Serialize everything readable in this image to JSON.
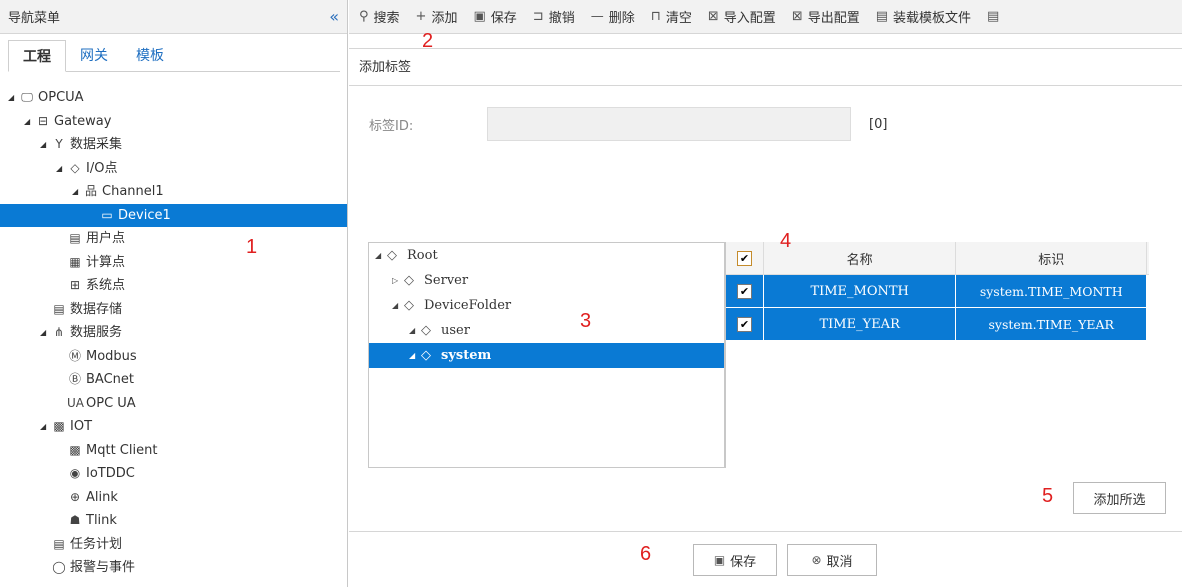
{
  "nav": {
    "title": "导航菜单",
    "collapse_icon": "«",
    "tabs": [
      {
        "label": "工程",
        "active": true
      },
      {
        "label": "网关",
        "active": false
      },
      {
        "label": "模板",
        "active": false
      }
    ],
    "tree": [
      {
        "label": "OPCUA",
        "level": 0,
        "arrow": "◢",
        "icon": "monitor-icon",
        "glyph": "🖵"
      },
      {
        "label": "Gateway",
        "level": 1,
        "arrow": "◢",
        "icon": "gateway-icon",
        "glyph": "⊟"
      },
      {
        "label": "数据采集",
        "level": 2,
        "arrow": "◢",
        "icon": "collect-icon",
        "glyph": "Y"
      },
      {
        "label": "I/O点",
        "level": 3,
        "arrow": "◢",
        "icon": "tag-icon",
        "glyph": "◇"
      },
      {
        "label": "Channel1",
        "level": 4,
        "arrow": "◢",
        "icon": "channel-icon",
        "glyph": "品"
      },
      {
        "label": "Device1",
        "level": 5,
        "arrow": "",
        "icon": "device-icon",
        "glyph": "▭",
        "selected": true
      },
      {
        "label": "用户点",
        "level": 3,
        "arrow": "",
        "icon": "user-point-icon",
        "glyph": "▤"
      },
      {
        "label": "计算点",
        "level": 3,
        "arrow": "",
        "icon": "calc-point-icon",
        "glyph": "▦"
      },
      {
        "label": "系统点",
        "level": 3,
        "arrow": "",
        "icon": "system-point-icon",
        "glyph": "⊞"
      },
      {
        "label": "数据存储",
        "level": 2,
        "arrow": "",
        "icon": "storage-icon",
        "glyph": "▤"
      },
      {
        "label": "数据服务",
        "level": 2,
        "arrow": "◢",
        "icon": "service-icon",
        "glyph": "⋔"
      },
      {
        "label": "Modbus",
        "level": 3,
        "arrow": "",
        "icon": "modbus-icon",
        "glyph": "Ⓜ"
      },
      {
        "label": "BACnet",
        "level": 3,
        "arrow": "",
        "icon": "bacnet-icon",
        "glyph": "Ⓑ"
      },
      {
        "label": "OPC UA",
        "level": 3,
        "arrow": "",
        "icon": "opcua-icon",
        "glyph": "UA"
      },
      {
        "label": "IOT",
        "level": 2,
        "arrow": "◢",
        "icon": "iot-icon",
        "glyph": "▩"
      },
      {
        "label": "Mqtt Client",
        "level": 3,
        "arrow": "",
        "icon": "mqtt-icon",
        "glyph": "▩"
      },
      {
        "label": "IoTDDC",
        "level": 3,
        "arrow": "",
        "icon": "iotddc-icon",
        "glyph": "◉"
      },
      {
        "label": "Alink",
        "level": 3,
        "arrow": "",
        "icon": "alink-icon",
        "glyph": "⊕"
      },
      {
        "label": "Tlink",
        "level": 3,
        "arrow": "",
        "icon": "tlink-icon",
        "glyph": "☗"
      },
      {
        "label": "任务计划",
        "level": 2,
        "arrow": "",
        "icon": "task-icon",
        "glyph": "▤"
      },
      {
        "label": "报警与事件",
        "level": 2,
        "arrow": "",
        "icon": "alarm-icon",
        "glyph": "◯"
      }
    ]
  },
  "toolbar": [
    {
      "label": "搜索",
      "icon": "search-icon",
      "glyph": "⚲"
    },
    {
      "label": "添加",
      "icon": "plus-icon",
      "glyph": "+"
    },
    {
      "label": "保存",
      "icon": "save-icon",
      "glyph": "▣"
    },
    {
      "label": "撤销",
      "icon": "undo-icon",
      "glyph": "⊐"
    },
    {
      "label": "删除",
      "icon": "minus-icon",
      "glyph": "—"
    },
    {
      "label": "清空",
      "icon": "trash-icon",
      "glyph": "⊓"
    },
    {
      "label": "导入配置",
      "icon": "import-icon",
      "glyph": "⊠"
    },
    {
      "label": "导出配置",
      "icon": "export-icon",
      "glyph": "⊠"
    },
    {
      "label": "装载模板文件",
      "icon": "file-icon",
      "glyph": "▤"
    },
    {
      "label": "",
      "icon": "file-icon",
      "glyph": "▤"
    }
  ],
  "dialog": {
    "title": "添加标签",
    "tag_id_label": "标签ID:",
    "tag_id_value": "",
    "tag_index": "[0]",
    "tag_tree": [
      {
        "label": "Root",
        "level": 0,
        "arrow": "◢"
      },
      {
        "label": "Server",
        "level": 1,
        "arrow": "▷"
      },
      {
        "label": "DeviceFolder",
        "level": 1,
        "arrow": "◢"
      },
      {
        "label": "user",
        "level": 2,
        "arrow": "◢"
      },
      {
        "label": "system",
        "level": 2,
        "arrow": "◢",
        "selected": true
      }
    ],
    "grid": {
      "headers": {
        "name": "名称",
        "ident": "标识"
      },
      "header_checked": true,
      "rows": [
        {
          "checked": true,
          "name": "TIME_MONTH",
          "ident": "system.TIME_MONTH"
        },
        {
          "checked": true,
          "name": "TIME_YEAR",
          "ident": "system.TIME_YEAR"
        }
      ]
    },
    "add_selected_label": "添加所选",
    "save_label": "保存",
    "cancel_label": "取消"
  },
  "annotations": [
    "1",
    "2",
    "3",
    "4",
    "5",
    "6"
  ],
  "colors": {
    "accent": "#0a7ad4",
    "annotation": "#e02020",
    "link": "#1f6fc1"
  }
}
